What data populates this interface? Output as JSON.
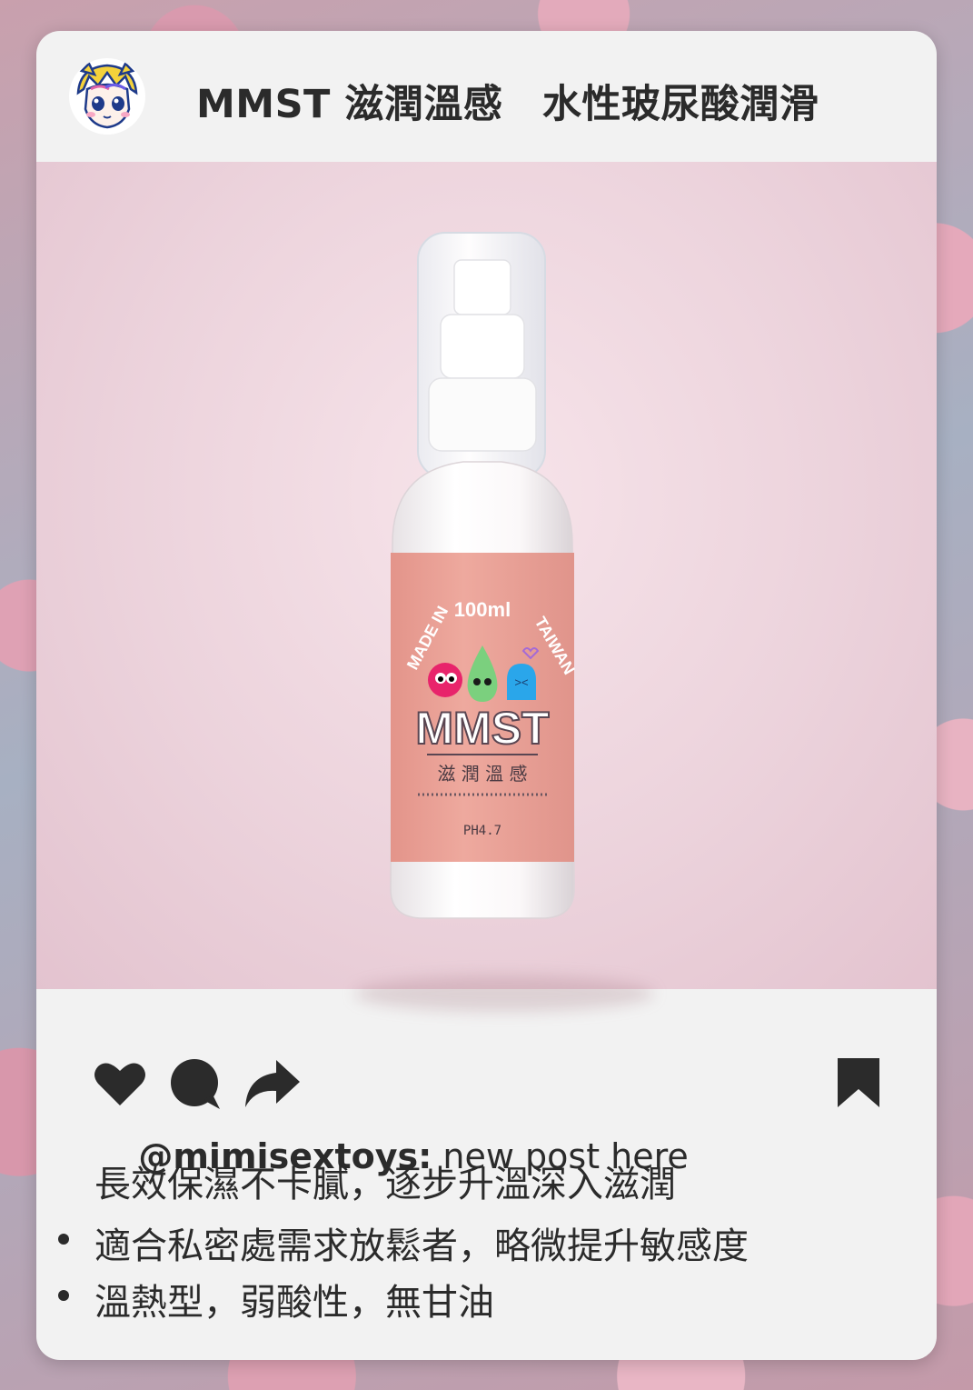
{
  "post": {
    "title": "MMST 滋潤溫感　水性玻尿酸潤滑",
    "avatar_icon": "cartoon-tiger-avatar-icon",
    "photo": {
      "product_label_lines": [
        "MADE IN 100ml TAIWAN",
        "MMST",
        "滋 潤 溫 感",
        "PH4.7"
      ]
    }
  },
  "actions": {
    "like_icon": "heart-icon",
    "comment_icon": "comment-bubble-icon",
    "share_icon": "share-arrow-icon",
    "save_icon": "bookmark-icon"
  },
  "caption": {
    "username": "@mimisextoys:",
    "text": " new post here",
    "line1": "長效保濕不卡膩，逐步升溫深入滋潤",
    "bullets": [
      "適合私密處需求放鬆者，略微提升敏感度",
      "溫熱型，弱酸性，無甘油"
    ]
  },
  "colors": {
    "card": "#f2f2f2",
    "text": "#2b2b2b",
    "label_pink": "#eca397",
    "photo_bg": "#ecd3dc"
  }
}
